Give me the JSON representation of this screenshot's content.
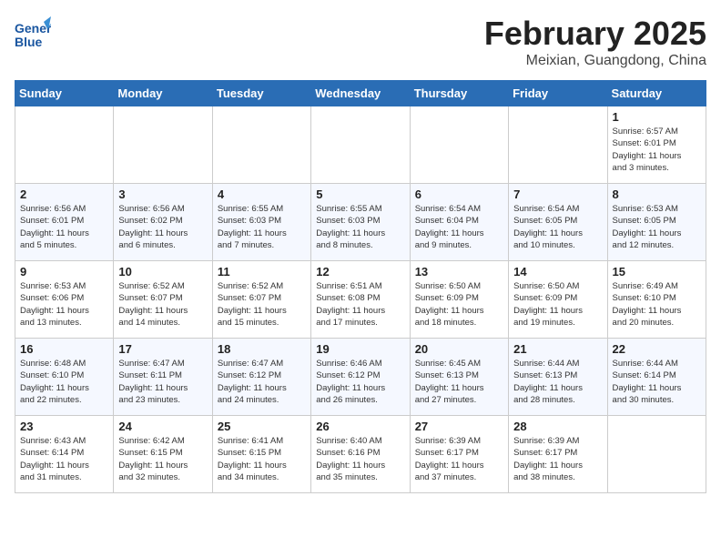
{
  "header": {
    "logo_line1": "General",
    "logo_line2": "Blue",
    "month": "February 2025",
    "location": "Meixian, Guangdong, China"
  },
  "weekdays": [
    "Sunday",
    "Monday",
    "Tuesday",
    "Wednesday",
    "Thursday",
    "Friday",
    "Saturday"
  ],
  "weeks": [
    [
      {
        "day": "",
        "info": ""
      },
      {
        "day": "",
        "info": ""
      },
      {
        "day": "",
        "info": ""
      },
      {
        "day": "",
        "info": ""
      },
      {
        "day": "",
        "info": ""
      },
      {
        "day": "",
        "info": ""
      },
      {
        "day": "1",
        "info": "Sunrise: 6:57 AM\nSunset: 6:01 PM\nDaylight: 11 hours\nand 3 minutes."
      }
    ],
    [
      {
        "day": "2",
        "info": "Sunrise: 6:56 AM\nSunset: 6:01 PM\nDaylight: 11 hours\nand 5 minutes."
      },
      {
        "day": "3",
        "info": "Sunrise: 6:56 AM\nSunset: 6:02 PM\nDaylight: 11 hours\nand 6 minutes."
      },
      {
        "day": "4",
        "info": "Sunrise: 6:55 AM\nSunset: 6:03 PM\nDaylight: 11 hours\nand 7 minutes."
      },
      {
        "day": "5",
        "info": "Sunrise: 6:55 AM\nSunset: 6:03 PM\nDaylight: 11 hours\nand 8 minutes."
      },
      {
        "day": "6",
        "info": "Sunrise: 6:54 AM\nSunset: 6:04 PM\nDaylight: 11 hours\nand 9 minutes."
      },
      {
        "day": "7",
        "info": "Sunrise: 6:54 AM\nSunset: 6:05 PM\nDaylight: 11 hours\nand 10 minutes."
      },
      {
        "day": "8",
        "info": "Sunrise: 6:53 AM\nSunset: 6:05 PM\nDaylight: 11 hours\nand 12 minutes."
      }
    ],
    [
      {
        "day": "9",
        "info": "Sunrise: 6:53 AM\nSunset: 6:06 PM\nDaylight: 11 hours\nand 13 minutes."
      },
      {
        "day": "10",
        "info": "Sunrise: 6:52 AM\nSunset: 6:07 PM\nDaylight: 11 hours\nand 14 minutes."
      },
      {
        "day": "11",
        "info": "Sunrise: 6:52 AM\nSunset: 6:07 PM\nDaylight: 11 hours\nand 15 minutes."
      },
      {
        "day": "12",
        "info": "Sunrise: 6:51 AM\nSunset: 6:08 PM\nDaylight: 11 hours\nand 17 minutes."
      },
      {
        "day": "13",
        "info": "Sunrise: 6:50 AM\nSunset: 6:09 PM\nDaylight: 11 hours\nand 18 minutes."
      },
      {
        "day": "14",
        "info": "Sunrise: 6:50 AM\nSunset: 6:09 PM\nDaylight: 11 hours\nand 19 minutes."
      },
      {
        "day": "15",
        "info": "Sunrise: 6:49 AM\nSunset: 6:10 PM\nDaylight: 11 hours\nand 20 minutes."
      }
    ],
    [
      {
        "day": "16",
        "info": "Sunrise: 6:48 AM\nSunset: 6:10 PM\nDaylight: 11 hours\nand 22 minutes."
      },
      {
        "day": "17",
        "info": "Sunrise: 6:47 AM\nSunset: 6:11 PM\nDaylight: 11 hours\nand 23 minutes."
      },
      {
        "day": "18",
        "info": "Sunrise: 6:47 AM\nSunset: 6:12 PM\nDaylight: 11 hours\nand 24 minutes."
      },
      {
        "day": "19",
        "info": "Sunrise: 6:46 AM\nSunset: 6:12 PM\nDaylight: 11 hours\nand 26 minutes."
      },
      {
        "day": "20",
        "info": "Sunrise: 6:45 AM\nSunset: 6:13 PM\nDaylight: 11 hours\nand 27 minutes."
      },
      {
        "day": "21",
        "info": "Sunrise: 6:44 AM\nSunset: 6:13 PM\nDaylight: 11 hours\nand 28 minutes."
      },
      {
        "day": "22",
        "info": "Sunrise: 6:44 AM\nSunset: 6:14 PM\nDaylight: 11 hours\nand 30 minutes."
      }
    ],
    [
      {
        "day": "23",
        "info": "Sunrise: 6:43 AM\nSunset: 6:14 PM\nDaylight: 11 hours\nand 31 minutes."
      },
      {
        "day": "24",
        "info": "Sunrise: 6:42 AM\nSunset: 6:15 PM\nDaylight: 11 hours\nand 32 minutes."
      },
      {
        "day": "25",
        "info": "Sunrise: 6:41 AM\nSunset: 6:15 PM\nDaylight: 11 hours\nand 34 minutes."
      },
      {
        "day": "26",
        "info": "Sunrise: 6:40 AM\nSunset: 6:16 PM\nDaylight: 11 hours\nand 35 minutes."
      },
      {
        "day": "27",
        "info": "Sunrise: 6:39 AM\nSunset: 6:17 PM\nDaylight: 11 hours\nand 37 minutes."
      },
      {
        "day": "28",
        "info": "Sunrise: 6:39 AM\nSunset: 6:17 PM\nDaylight: 11 hours\nand 38 minutes."
      },
      {
        "day": "",
        "info": ""
      }
    ]
  ]
}
